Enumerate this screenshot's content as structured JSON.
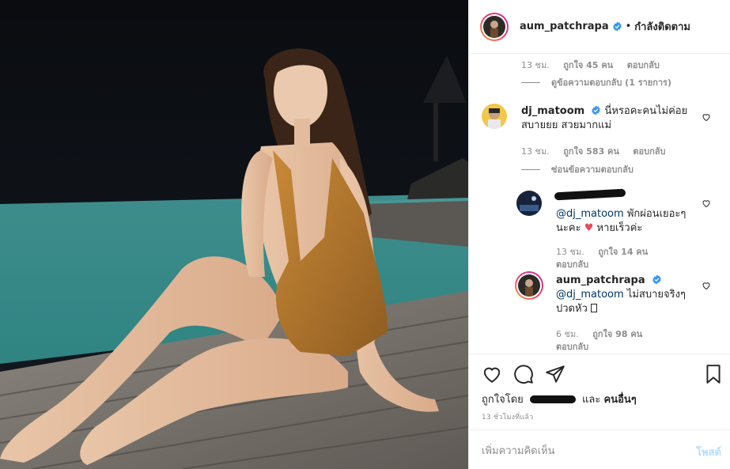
{
  "post": {
    "author": "aum_patchrapa",
    "follow_status": "กำลังติดตาม",
    "separator": "•"
  },
  "comments": {
    "top_meta": {
      "time": "13 ชม.",
      "likes": "ถูกใจ 45 คน",
      "reply": "ตอบกลับ"
    },
    "view_replies": "ดูข้อความตอบกลับ (1 รายการ)",
    "items": [
      {
        "user": "dj_matoom",
        "verified": true,
        "text_line1": "นี่หรอคะคนไม่ค่อย",
        "text_line2": "สบายยย สวยมากแม่",
        "time": "13 ชม.",
        "likes": "ถูกใจ 583 คน",
        "reply": "ตอบกลับ",
        "hide_replies": "ซ่อนข้อความตอบกลับ"
      }
    ],
    "replies": [
      {
        "mention": "@dj_matoom",
        "text_line1": "พักผ่อนเยอะๆ",
        "text_line2a": "นะคะ",
        "text_line2b": "หายเร็วค่ะ",
        "time": "13 ชม.",
        "likes": "ถูกใจ 14 คน",
        "reply": "ตอบกลับ"
      },
      {
        "user": "aum_patchrapa",
        "verified": true,
        "mention": "@dj_matoom",
        "text_line1": "ไม่สบายจริงๆ",
        "text_line2": "ปวดหัว",
        "time": "6 ชม.",
        "likes": "ถูกใจ 98 คน",
        "reply": "ตอบกลับ"
      }
    ]
  },
  "actions": {
    "liked_by_prefix": "ถูกใจโดย",
    "liked_by_and": "และ",
    "liked_by_others": "คนอื่นๆ",
    "time_ago": "13 ชั่วโมงที่แล้ว"
  },
  "add_comment": {
    "placeholder": "เพิ่มความคิดเห็น",
    "post_label": "โพสต์"
  },
  "colors": {
    "verified_blue": "#3897f0",
    "text": "#262626",
    "muted": "#8e8e8e",
    "post_disabled": "#b2dffc",
    "heart_red": "#ed4956"
  }
}
